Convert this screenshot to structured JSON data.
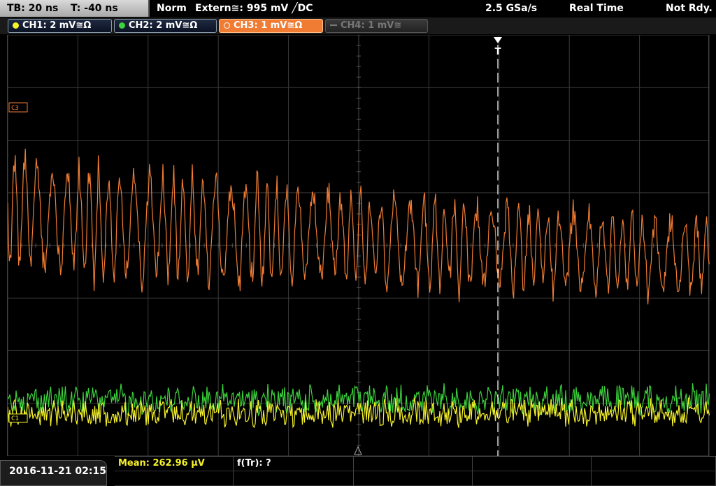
{
  "topbar": {
    "timebase": "TB: 20 ns",
    "trigger_time": "T: -40 ns",
    "trigger_mode": "Norm",
    "trigger_source": "Extern≅: 995 mV ╱DC",
    "sample_rate": "2.5 GSa/s",
    "acq_mode": "Real Time",
    "status": "Not Rdy."
  },
  "channels": [
    {
      "label": "CH1: 2 mV≅Ω",
      "color": "#f6f22a",
      "state": "on"
    },
    {
      "label": "CH2: 2 mV≅Ω",
      "color": "#3cd23c",
      "state": "on"
    },
    {
      "label": "CH3: 1 mV≅Ω",
      "color": "#f07c34",
      "state": "selected"
    },
    {
      "label": "CH4: 1 mV≅",
      "color": "#777777",
      "state": "off"
    }
  ],
  "markers": {
    "ch3": "C3",
    "ch1": "C1",
    "trigger": "T"
  },
  "measurements": {
    "mean": "Mean: 262.96 μV",
    "ftr": "f(Tr): ?"
  },
  "datetime": "2016-11-21 02:15"
}
